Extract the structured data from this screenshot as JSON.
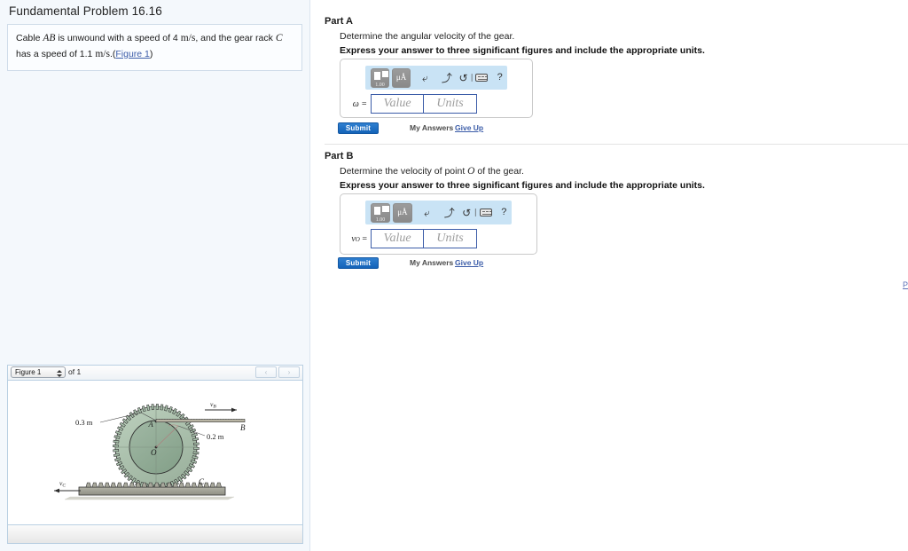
{
  "problem": {
    "title": "Fundamental Problem 16.16",
    "statement_part1": "Cable",
    "statement_ab": "AB",
    "statement_part2": "is unwound with a speed of 4",
    "unit_ms": "m/s",
    "statement_part3": ", and the gear rack",
    "statement_c": "C",
    "statement_part4": "has a speed of 1.1",
    "statement_part5": ".(",
    "figure_link": "Figure 1",
    "statement_end": ")"
  },
  "figure": {
    "selector_value": "Figure 1",
    "of_label": "of 1",
    "prev_arrow": "‹",
    "next_arrow": "›",
    "labels": {
      "radius_outer": "0.3 m",
      "radius_inner": "0.2 m",
      "point_A": "A",
      "point_B": "B",
      "point_C": "C",
      "point_O": "O",
      "v_B": "v",
      "v_B_sub": "B",
      "v_C": "v",
      "v_C_sub": "C"
    },
    "colors": {
      "gear_fill": "#a9c0ac",
      "hub_fill": "#8fab93",
      "rack_fill": "#9a9a8f",
      "outline": "#2b2b2b"
    }
  },
  "parts": [
    {
      "heading": "Part A",
      "question": "Determine the angular velocity of the gear.",
      "instruction": "Express your answer to three significant figures and include the appropriate units.",
      "answer_label": "ω =",
      "value_placeholder": "Value",
      "units_placeholder": "Units",
      "submit_label": "Submit",
      "my_answers_label": "My Answers",
      "give_up_label": "Give Up"
    },
    {
      "heading": "Part B",
      "question_pre": "Determine the velocity of point",
      "question_point": "O",
      "question_post": "of the gear.",
      "question": "Determine the velocity of point O of the gear.",
      "instruction": "Express your answer to three significant figures and include the appropriate units.",
      "answer_label_main": "v",
      "answer_label_sub": "O",
      "answer_label_eq": "=",
      "value_placeholder": "Value",
      "units_placeholder": "Units",
      "submit_label": "Submit",
      "my_answers_label": "My Answers",
      "give_up_label": "Give Up"
    }
  ],
  "toolbar": {
    "template_button_label": "1.00",
    "units_button_label": "μÅ",
    "undo_icon": "⤶",
    "redo_icon": "⤴",
    "reset_icon": "↺",
    "help_icon": "?",
    "keyboard_icon": "keyboard",
    "bracket_icon": "∣"
  },
  "edge": {
    "partial_link": "P"
  },
  "accent": {
    "blue": "#1463b8",
    "link": "#3b5ca8",
    "toolbar_bg": "#c9e3f5",
    "panel_bg": "#f4f8fc"
  }
}
